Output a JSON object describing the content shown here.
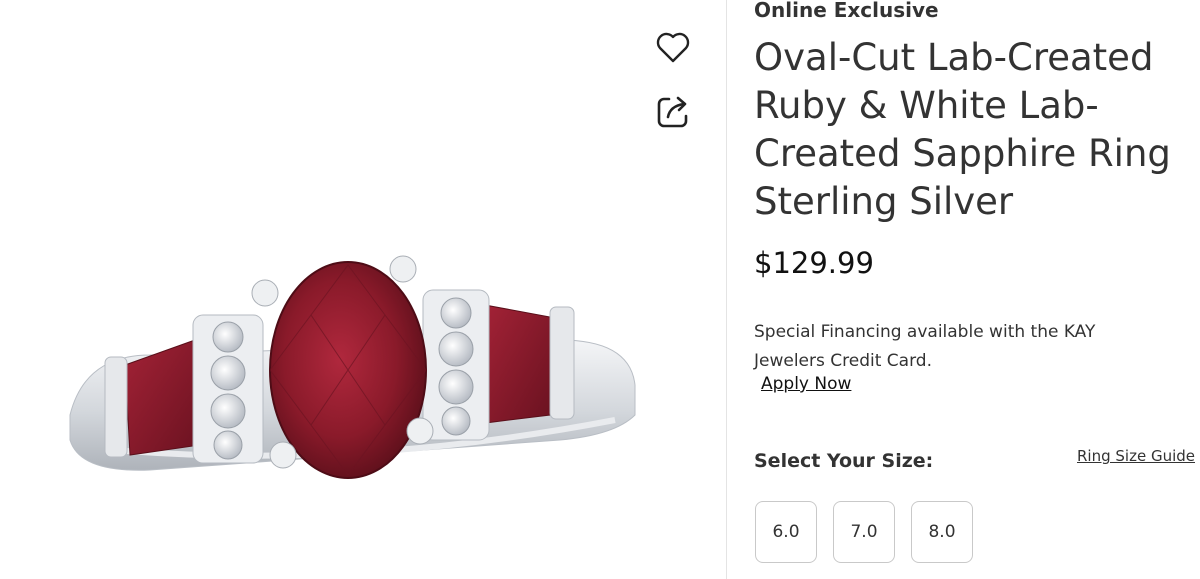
{
  "product": {
    "badge": "Online Exclusive",
    "title": "Oval-Cut Lab-Created Ruby & White Lab-Created Sapphire Ring Sterling Silver",
    "price": "$129.99",
    "financing_text": "Special Financing available with the KAY Jewelers Credit Card.",
    "apply_link": "Apply Now"
  },
  "sizes": {
    "heading": "Select Your Size:",
    "guide_link": "Ring Size Guide",
    "options": [
      "6.0",
      "7.0",
      "8.0"
    ]
  },
  "icons": {
    "wishlist": "heart-icon",
    "share": "share-icon"
  },
  "colors": {
    "ruby": "#8e1c2c",
    "metal": "#d9dde2",
    "text": "#333333"
  }
}
